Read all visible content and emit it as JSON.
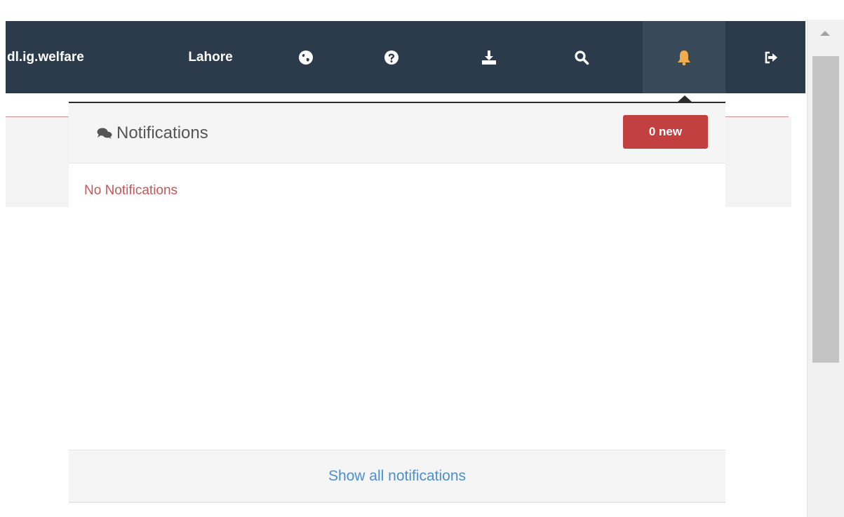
{
  "navbar": {
    "username": "dl.ig.welfare",
    "city": "Lahore",
    "icons": [
      "globe-icon",
      "question-icon",
      "download-icon",
      "search-icon",
      "bell-icon",
      "sign-out-icon"
    ],
    "background": "#2c3b4c",
    "active_background": "#38495a",
    "bell_color": "#f0ad4e"
  },
  "notifications": {
    "icon": "comments-icon",
    "title": "Notifications",
    "badge": "0 new",
    "badge_color": "#c24040",
    "empty_text": "No Notifications",
    "empty_color": "#c7565a",
    "footer_link": "Show all notifications",
    "link_color": "#4a8fd0"
  }
}
